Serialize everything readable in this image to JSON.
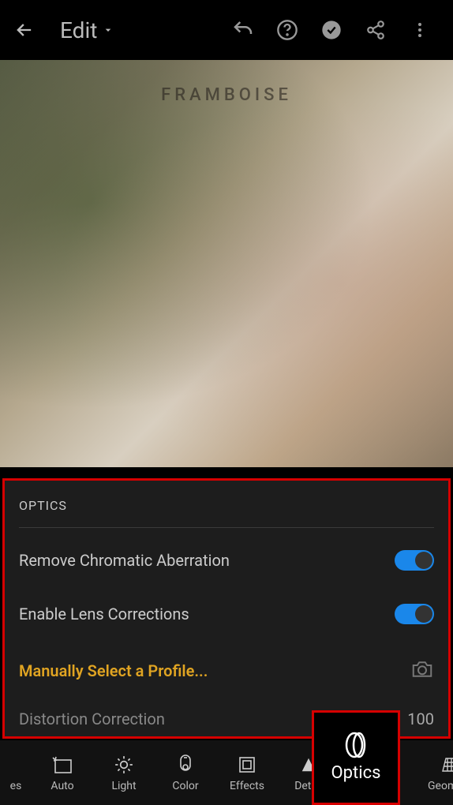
{
  "topbar": {
    "edit_label": "Edit"
  },
  "panel": {
    "title": "OPTICS",
    "rca_label": "Remove Chromatic Aberration",
    "rca_on": true,
    "elc_label": "Enable Lens Corrections",
    "elc_on": true,
    "manual_label": "Manually Select a Profile...",
    "distortion_label": "Distortion Correction",
    "distortion_value": "100"
  },
  "tabs": {
    "cut_label": "es",
    "auto": "Auto",
    "light": "Light",
    "color": "Color",
    "effects": "Effects",
    "detail": "Detail",
    "optics": "Optics",
    "geometry": "Geometry"
  }
}
